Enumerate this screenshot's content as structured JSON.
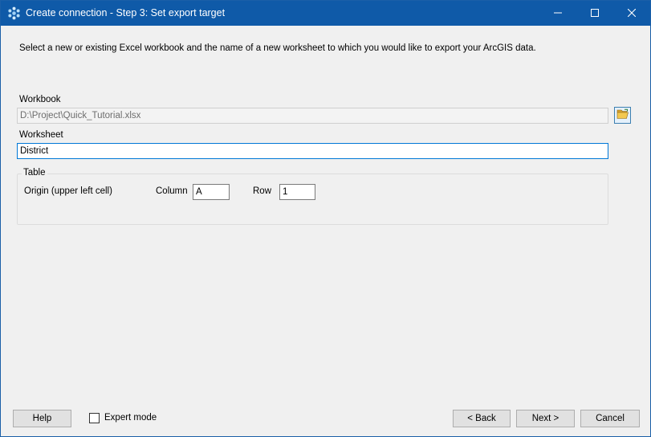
{
  "window": {
    "title": "Create connection - Step 3: Set export target",
    "app_icon": "gear-cluster-icon",
    "controls": [
      "minimize-icon",
      "maximize-icon",
      "close-icon"
    ]
  },
  "instruction": "Select a new or existing Excel workbook and the name of a new worksheet to which you would like to export your ArcGIS data.",
  "workbook": {
    "label": "Workbook",
    "value": "D:\\Project\\Quick_Tutorial.xlsx",
    "browse_icon": "folder-open-icon"
  },
  "worksheet": {
    "label": "Worksheet",
    "value": "District"
  },
  "table": {
    "legend": "Table",
    "origin_label": "Origin (upper left cell)",
    "column_label": "Column",
    "column_value": "A",
    "row_label": "Row",
    "row_value": "1"
  },
  "footer": {
    "help": "Help",
    "expert_mode": "Expert mode",
    "expert_mode_checked": false,
    "back": "< Back",
    "next": "Next >",
    "cancel": "Cancel"
  },
  "colors": {
    "titlebar": "#0f5aa8",
    "focus_border": "#0078d7"
  }
}
